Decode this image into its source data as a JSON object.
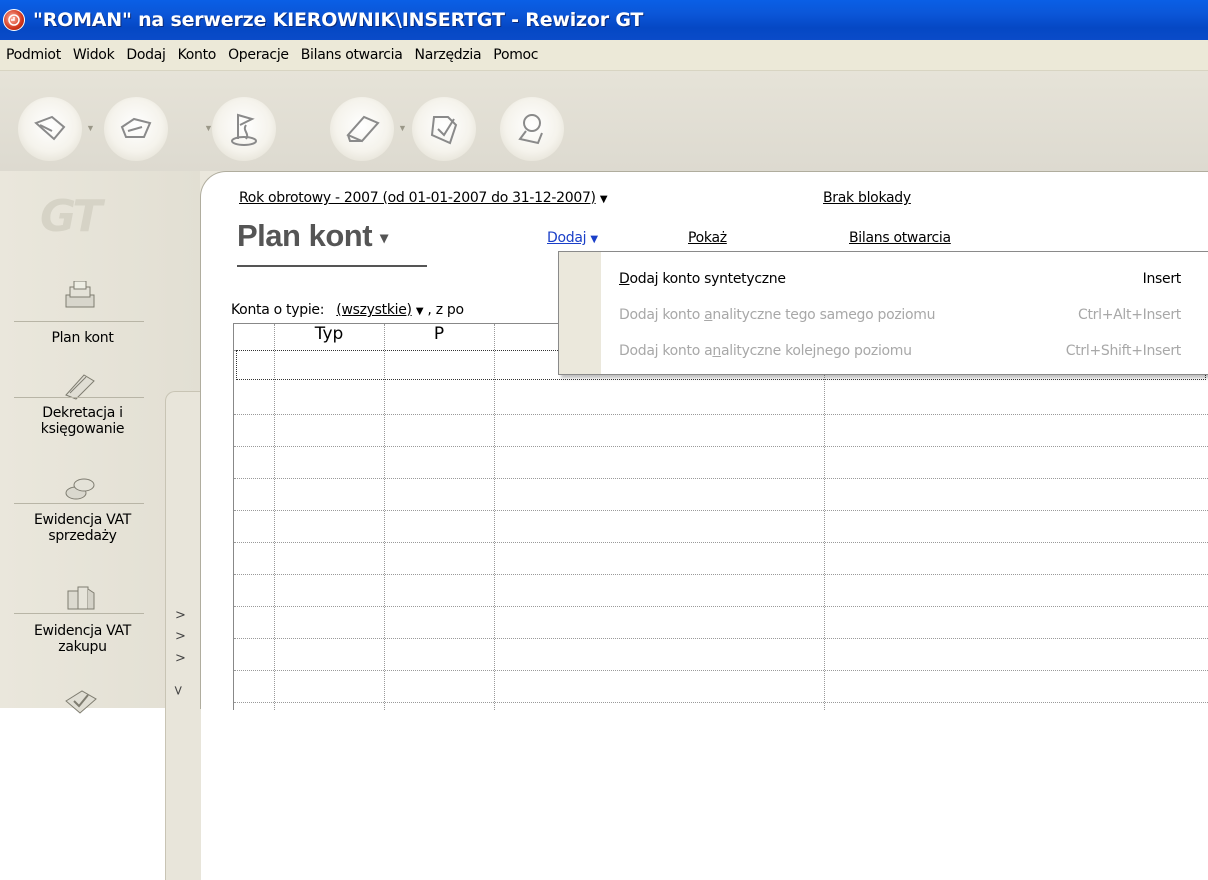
{
  "window": {
    "title": "\"ROMAN\" na serwerze KIEROWNIK\\INSERTGT - Rewizor GT",
    "app_icon": "rewizor-app-icon"
  },
  "menu": [
    "Podmiot",
    "Widok",
    "Dodaj",
    "Konto",
    "Operacje",
    "Bilans otwarcia",
    "Narzędzia",
    "Pomoc"
  ],
  "toolbar": {
    "buttons": [
      {
        "icon": "arrow-left-icon",
        "has_dropdown": true
      },
      {
        "icon": "arrow-right-icon",
        "has_dropdown": true
      },
      {
        "icon": "flag-icon",
        "has_dropdown": false
      },
      {
        "icon": "eraser-icon",
        "has_dropdown": true
      },
      {
        "icon": "check-doc-icon",
        "has_dropdown": false
      },
      {
        "icon": "stamp-icon",
        "has_dropdown": false
      }
    ]
  },
  "sidebar": {
    "logo_text": "GT",
    "items": [
      {
        "label": "Plan kont",
        "icon": "ledger-stack-icon"
      },
      {
        "label_line1": "Dekretacja i",
        "label_line2": "księgowanie",
        "icon": "pencil-icon"
      },
      {
        "label_line1": "Ewidencja VAT",
        "label_line2": "sprzedaży",
        "icon": "coins-icon"
      },
      {
        "label_line1": "Ewidencja VAT",
        "label_line2": "zakupu",
        "icon": "books-icon"
      },
      {
        "icon": "check-icon"
      }
    ],
    "chevrons": [
      ">",
      ">",
      ">",
      ">"
    ]
  },
  "header": {
    "fiscal_year": "Rok obrotowy - 2007  (od 01-01-2007 do 31-12-2007)",
    "lock_status": "Brak blokady"
  },
  "page": {
    "title": "Plan kont",
    "actions": {
      "add": "Dodaj",
      "show": "Pokaż",
      "opening_balance": "Bilans otwarcia"
    },
    "filter": {
      "label": "Konta o typie:",
      "value": "(wszystkie)",
      "suffix": ", z po"
    }
  },
  "table": {
    "columns": [
      "Typ",
      "P"
    ]
  },
  "dropdown": {
    "items": [
      {
        "label_pre": "",
        "label_ul": "D",
        "label_post": "odaj konto syntetyczne",
        "shortcut": "Insert",
        "enabled": true
      },
      {
        "label_pre": "Dodaj konto ",
        "label_ul": "a",
        "label_post": "nalityczne tego samego poziomu",
        "shortcut": "Ctrl+Alt+Insert",
        "enabled": false
      },
      {
        "label_pre": "Dodaj konto a",
        "label_ul": "n",
        "label_post": "alityczne kolejnego poziomu",
        "shortcut": "Ctrl+Shift+Insert",
        "enabled": false
      }
    ]
  },
  "colors": {
    "titlebar": "#0a56d8",
    "link_blue": "#1a3fc8",
    "menu_bg": "#ece9d8",
    "disabled": "#a8a8a8"
  }
}
